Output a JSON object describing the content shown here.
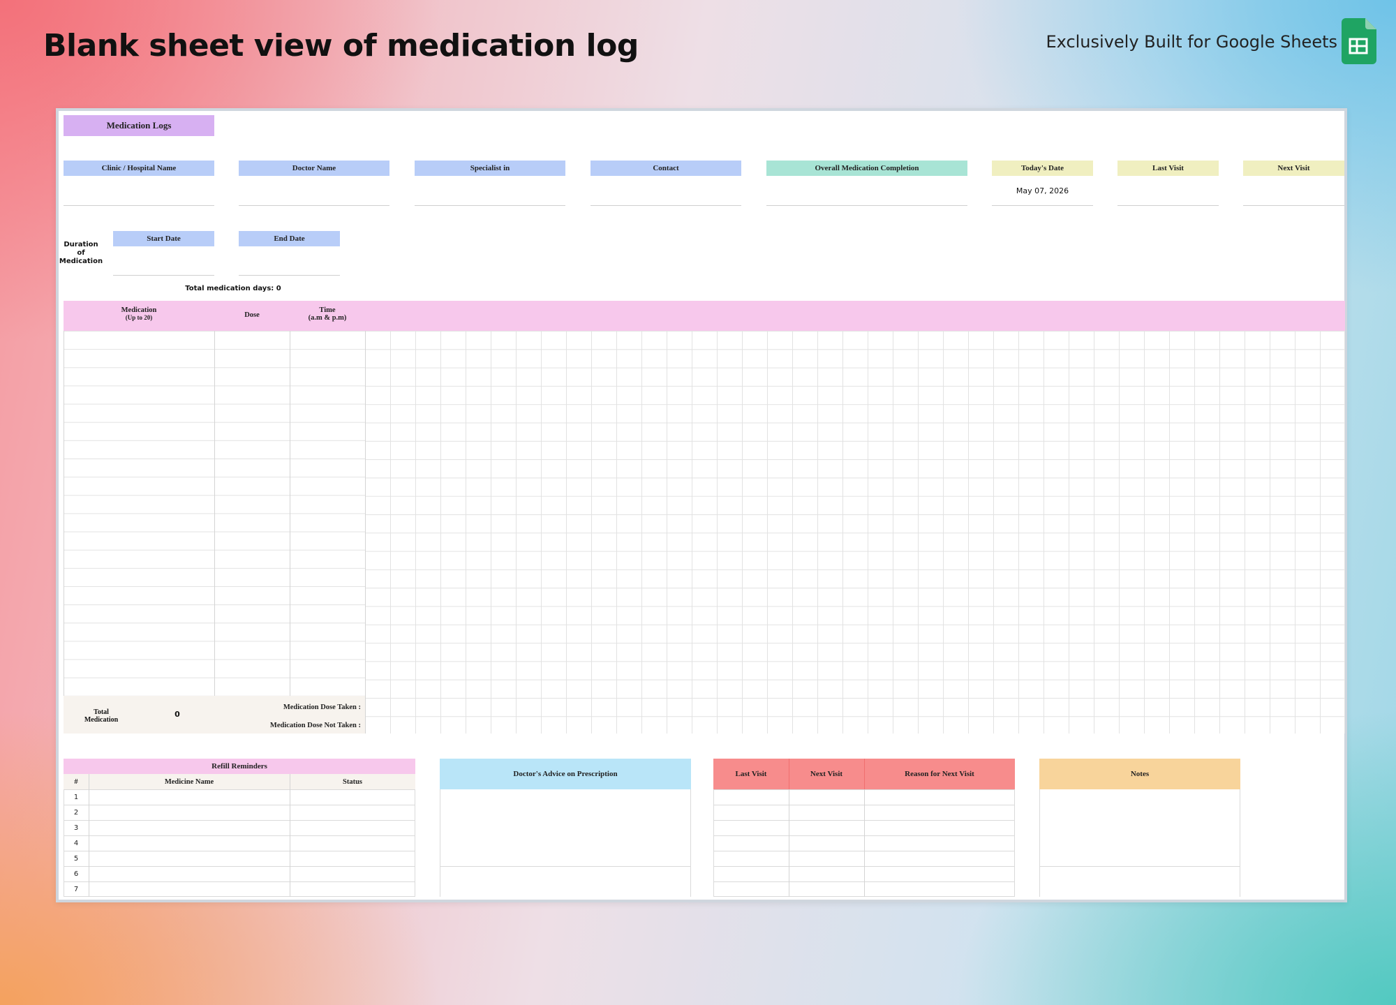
{
  "headline": "Blank sheet view of medication log",
  "brand": {
    "text": "Exclusively Built for  Google Sheets",
    "logo_icon": "google-sheets-icon",
    "logo_color": "#1fa463"
  },
  "sheet": {
    "title": "Medication Logs",
    "info_headers": {
      "clinic": "Clinic / Hospital Name",
      "doctor": "Doctor Name",
      "specialist": "Specialist in",
      "contact": "Contact",
      "completion": "Overall Medication Completion",
      "today": "Today's Date",
      "last_visit": "Last Visit",
      "next_visit": "Next Visit"
    },
    "today_value": "May 07, 2026",
    "duration": {
      "label_line1": "Duration",
      "label_line2": "of",
      "label_line3": "Medication",
      "start": "Start Date",
      "end": "End Date",
      "total_days": "Total medication days: 0"
    },
    "table_headers": {
      "medication_line1": "Medication",
      "medication_line2": "(Up to 20)",
      "dose": "Dose",
      "time_line1": "Time",
      "time_line2": "(a.m & p.m)"
    },
    "totals": {
      "total_label_line1": "Total",
      "total_label_line2": "Medication",
      "total_value": "0",
      "taken": "Medication Dose Taken :",
      "not_taken": "Medication Dose Not Taken :"
    },
    "refill": {
      "title": "Refill Reminders",
      "col_num": "#",
      "col_name": "Medicine Name",
      "col_status": "Status",
      "rows": [
        "1",
        "2",
        "3",
        "4",
        "5",
        "6",
        "7"
      ]
    },
    "advice": {
      "title": "Doctor's Advice on Prescription"
    },
    "visits": {
      "last": "Last Visit",
      "next": "Next Visit",
      "reason": "Reason for Next Visit"
    },
    "notes": {
      "title": "Notes"
    },
    "colors": {
      "blue": "#b8cdf8",
      "green": "#a8e4d5",
      "yellow": "#f0efc0",
      "pink": "#f7c8ec",
      "lavender": "#d7b0f2",
      "advice": "#b9e5f8",
      "visits": "#f78c8c",
      "notes": "#f8d49b"
    }
  }
}
